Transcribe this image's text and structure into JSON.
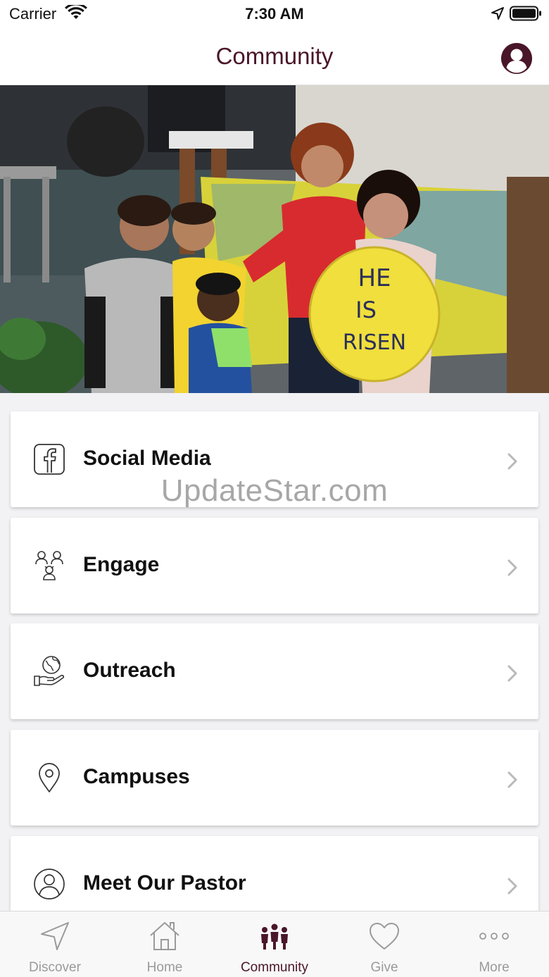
{
  "status_bar": {
    "carrier": "Carrier",
    "time": "7:30 AM"
  },
  "header": {
    "title": "Community"
  },
  "hero": {
    "sign_text_line1": "HE",
    "sign_text_line2": "IS",
    "sign_text_line3": "RISEN"
  },
  "menu": {
    "items": [
      {
        "label": "Social Media",
        "icon": "facebook-icon"
      },
      {
        "label": "Engage",
        "icon": "people-group-icon"
      },
      {
        "label": "Outreach",
        "icon": "globe-hand-icon"
      },
      {
        "label": "Campuses",
        "icon": "map-pin-icon"
      },
      {
        "label": "Meet Our Pastor",
        "icon": "person-circle-icon"
      }
    ]
  },
  "watermark": "UpdateStar.com",
  "tab_bar": {
    "tabs": [
      {
        "label": "Discover",
        "icon": "navigation-arrow-icon"
      },
      {
        "label": "Home",
        "icon": "house-icon"
      },
      {
        "label": "Community",
        "icon": "community-people-icon"
      },
      {
        "label": "Give",
        "icon": "heart-icon"
      },
      {
        "label": "More",
        "icon": "more-dots-icon"
      }
    ],
    "active": "Community"
  },
  "colors": {
    "brand": "#4a1629",
    "tab_inactive": "#9a9a9a",
    "background": "#f2f2f4"
  }
}
